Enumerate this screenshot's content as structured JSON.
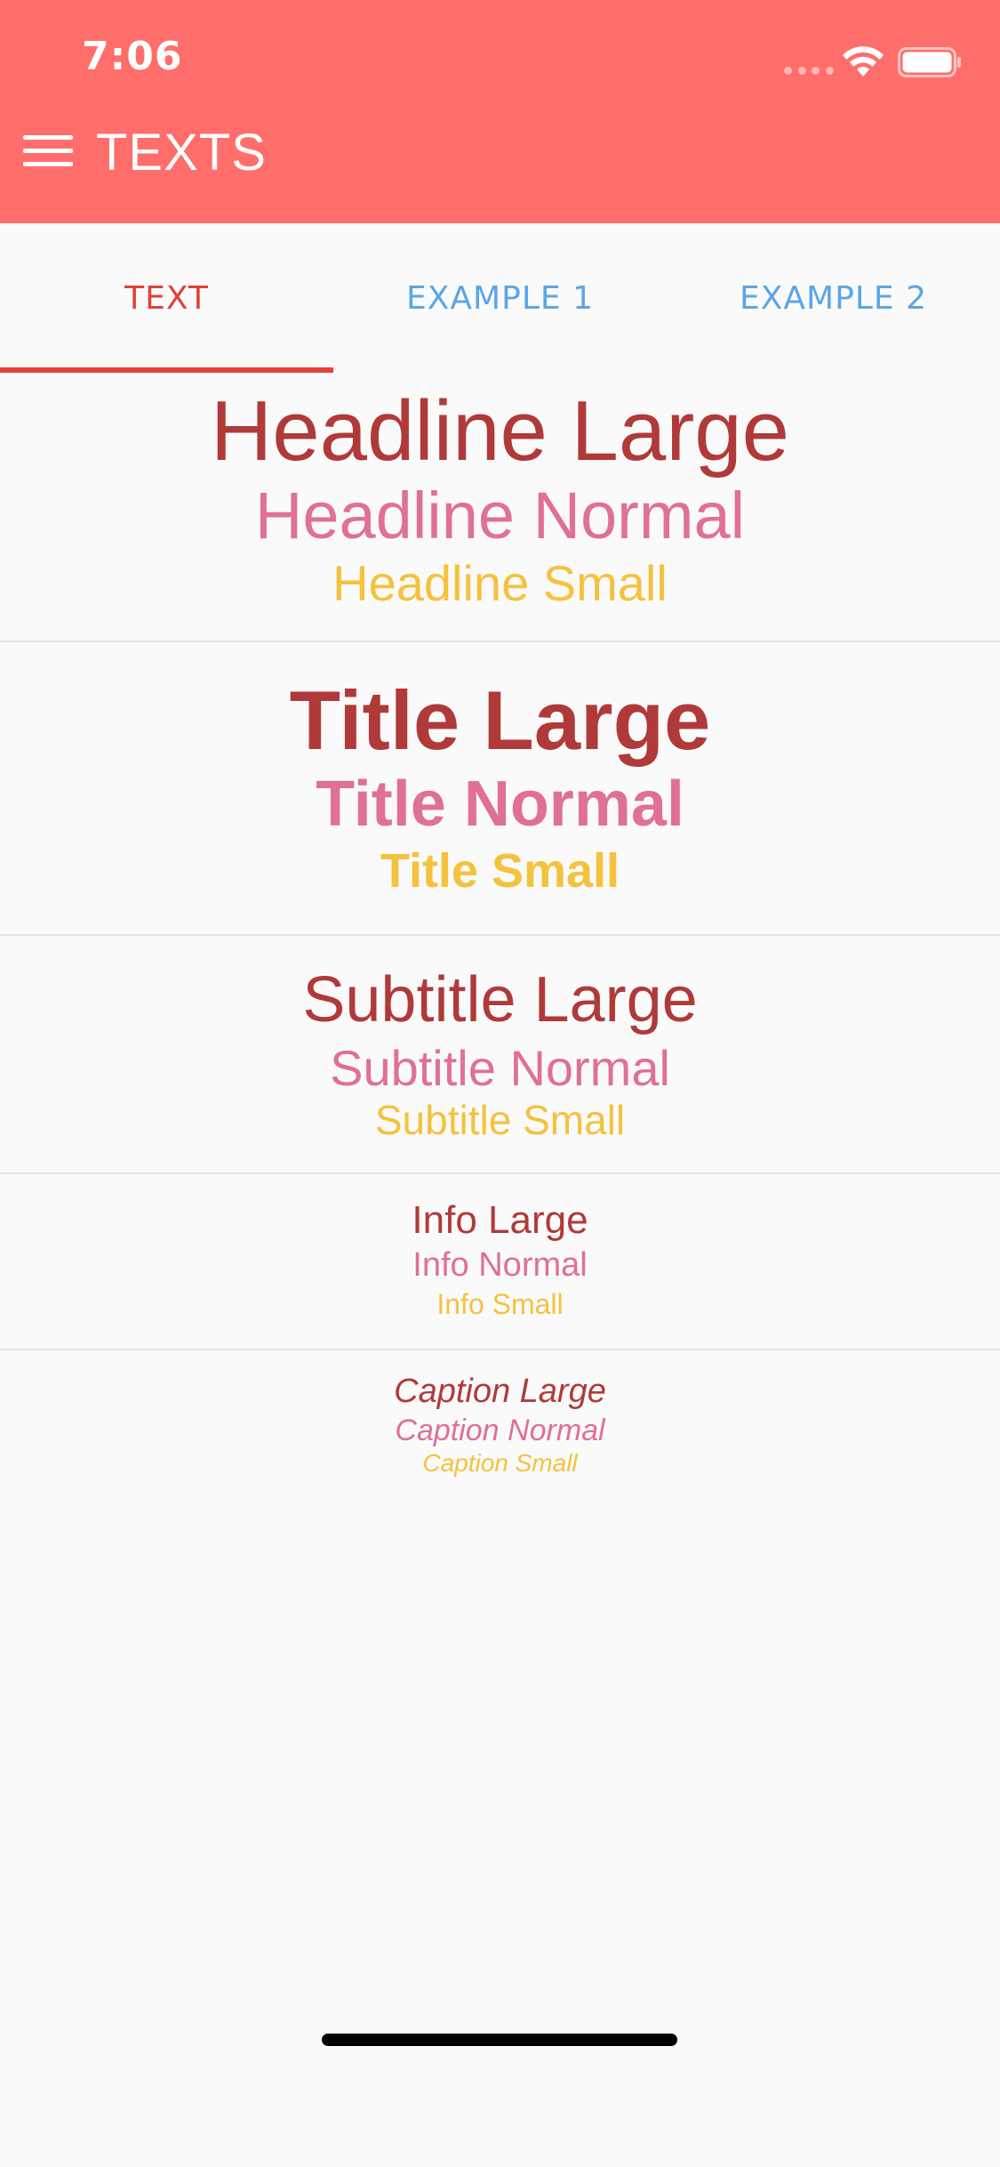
{
  "status_bar": {
    "time": "7:06"
  },
  "app_bar": {
    "title": "TEXTS"
  },
  "tabs": [
    {
      "label": "TEXT",
      "active": true
    },
    {
      "label": "EXAMPLE 1",
      "active": false
    },
    {
      "label": "EXAMPLE 2",
      "active": false
    }
  ],
  "sections": {
    "headline": {
      "large": "Headline Large",
      "normal": "Headline Normal",
      "small": "Headline Small"
    },
    "title": {
      "large": "Title Large",
      "normal": "Title Normal",
      "small": "Title Small"
    },
    "subtitle": {
      "large": "Subtitle Large",
      "normal": "Subtitle Normal",
      "small": "Subtitle Small"
    },
    "info": {
      "large": "Info Large",
      "normal": "Info Normal",
      "small": "Info Small"
    },
    "caption": {
      "large": "Caption Large",
      "normal": "Caption Normal",
      "small": "Caption Small"
    }
  },
  "colors": {
    "header_bg": "#ff6e6b",
    "active_tab": "#e0413b",
    "inactive_tab": "#5aa6e6",
    "large_text": "#b03a3a",
    "normal_text": "#e07095",
    "small_text": "#f5c23e"
  },
  "icons": {
    "menu": "menu-icon",
    "wifi": "wifi-icon",
    "battery": "battery-icon"
  }
}
